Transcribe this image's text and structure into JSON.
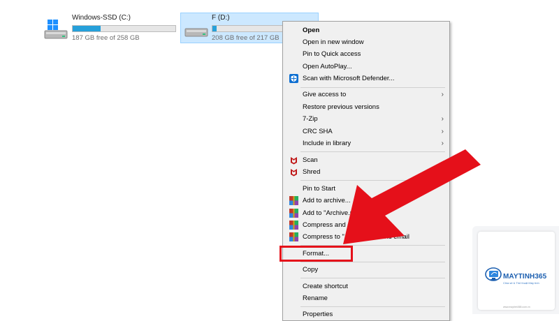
{
  "drives": [
    {
      "name": "Windows-SSD (C:)",
      "free_text": "187 GB free of 258 GB",
      "used_fraction": 0.275,
      "icon": "windows-drive-icon"
    },
    {
      "name": "F (D:)",
      "free_text": "208 GB free of 217 GB",
      "used_fraction": 0.04,
      "icon": "drive-icon",
      "selected": true
    }
  ],
  "menu": {
    "items": [
      {
        "label": "Open",
        "bold": true
      },
      {
        "label": "Open in new window"
      },
      {
        "label": "Pin to Quick access"
      },
      {
        "label": "Open AutoPlay..."
      },
      {
        "label": "Scan with Microsoft Defender...",
        "icon": "defender-shield-icon"
      },
      {
        "label": "Give access to",
        "submenu": true
      },
      {
        "label": "Restore previous versions"
      },
      {
        "label": "7-Zip",
        "submenu": true
      },
      {
        "label": "CRC SHA",
        "submenu": true
      },
      {
        "label": "Include in library",
        "submenu": true
      },
      {
        "label": "Scan",
        "icon": "mcafee-icon"
      },
      {
        "label": "Shred",
        "icon": "mcafee-icon"
      },
      {
        "label": "Pin to Start"
      },
      {
        "label": "Add to archive...",
        "icon": "winrar-icon"
      },
      {
        "label": "Add to \"Archive.rar\"",
        "icon": "winrar-icon"
      },
      {
        "label": "Compress and email...",
        "icon": "winrar-icon"
      },
      {
        "label": "Compress to \"Archive.rar\" and email",
        "icon": "winrar-icon"
      },
      {
        "label": "Format..."
      },
      {
        "label": "Copy"
      },
      {
        "label": "Create shortcut"
      },
      {
        "label": "Rename"
      },
      {
        "label": "Properties"
      }
    ]
  },
  "watermark": {
    "brand": "MAYTINH365",
    "tagline": "Chia sẻ & Thủ thuật Máy tính",
    "url": "www.maytinh365.com.vn"
  },
  "colors": {
    "accent": "#26a0da",
    "selection": "#cce8ff",
    "annotation_red": "#e5101a",
    "brand_blue": "#1c5fb0"
  }
}
